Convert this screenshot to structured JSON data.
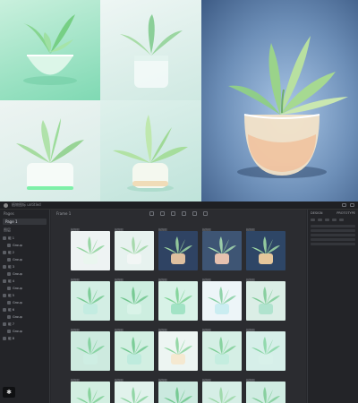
{
  "app": {
    "menubar_text": "植物图标 untitled",
    "canvas_frame_title": "Frame 1",
    "left_panel": {
      "section_pages": "Pages",
      "page_selected": "Page 1",
      "section_layers": "图层",
      "layers": [
        "组 1",
        "Group",
        "组 2",
        "Group",
        "组 3",
        "Group",
        "组 4",
        "Group",
        "组 5",
        "Group",
        "组 6",
        "Group",
        "组 7",
        "Group",
        "组 8"
      ],
      "bottom_button_icon": "figma-icon"
    },
    "right_panel": {
      "tab_design": "DESIGN",
      "tab_prototype": "PROTOTYPE"
    }
  },
  "grid": {
    "label": "植物图",
    "tiles": [
      {
        "bg": "#eef3f3",
        "pot": "#e9f5ee",
        "leaf": "#8ed39b"
      },
      {
        "bg": "#e7f2ef",
        "pot": "#f2f6f4",
        "leaf": "#9ed6a4"
      },
      {
        "bg": "#2f4363",
        "pot": "#e8c6a2",
        "leaf": "#9ed7a2"
      },
      {
        "bg": "#3e5574",
        "pot": "#efc7b2",
        "leaf": "#a7dcb0"
      },
      {
        "bg": "#2e4666",
        "pot": "#f0cf9e",
        "leaf": "#9fd8a4"
      },
      {
        "bg": "#d3eee4",
        "pot": "#c2ebe0",
        "leaf": "#73c98f"
      },
      {
        "bg": "#cdeee0",
        "pot": "#d9f2e8",
        "leaf": "#6fc58c"
      },
      {
        "bg": "#d8f2e7",
        "pot": "#9fe2c3",
        "leaf": "#7cd193"
      },
      {
        "bg": "#edf5f8",
        "pot": "#c8ecf0",
        "leaf": "#86cfa2"
      },
      {
        "bg": "#dbeee6",
        "pot": "#aee1cc",
        "leaf": "#7ecb97"
      },
      {
        "bg": "#cdeadf",
        "pot": "#cdeee3",
        "leaf": "#7ed09a"
      },
      {
        "bg": "#d2efe2",
        "pot": "#bdeadc",
        "leaf": "#72c990"
      },
      {
        "bg": "#edf5f2",
        "pot": "#f6e8cf",
        "leaf": "#8bd49d"
      },
      {
        "bg": "#d5efe5",
        "pot": "#c3ecde",
        "leaf": "#80cf98"
      },
      {
        "bg": "#d6efe9",
        "pot": "#d8f0ea",
        "leaf": "#8ad6a6"
      },
      {
        "bg": "#d2eee1",
        "pot": "#eef1e4",
        "leaf": "#7fcf95"
      },
      {
        "bg": "#e1f2ec",
        "pot": "#e5f3ef",
        "leaf": "#8ad39f"
      },
      {
        "bg": "#cbe9df",
        "pot": "#86d9b9",
        "leaf": "#6ec78c"
      },
      {
        "bg": "#d6eee6",
        "pot": "#f0d9c2",
        "leaf": "#9bd7a6"
      },
      {
        "bg": "#d0ece2",
        "pot": "#d7f0e6",
        "leaf": "#7fcd98"
      }
    ]
  }
}
